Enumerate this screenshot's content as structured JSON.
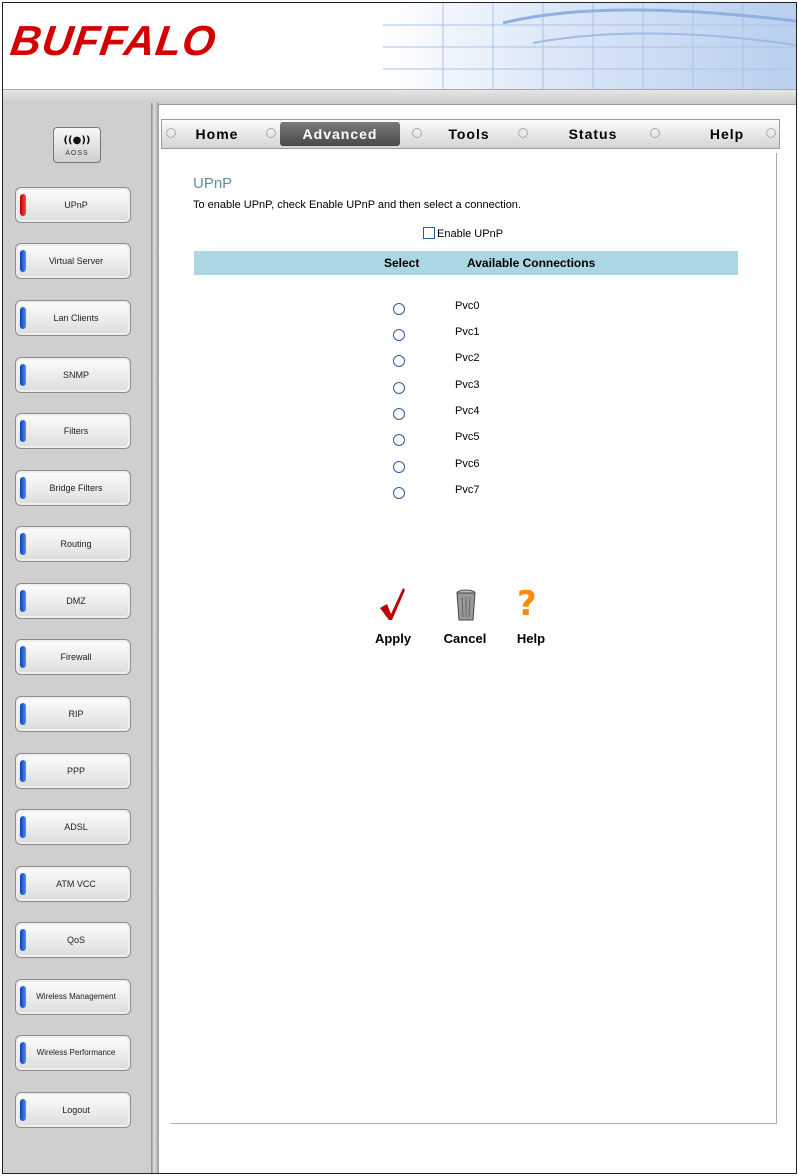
{
  "brand": {
    "logo_text": "BUFFALO"
  },
  "aoss": {
    "label": "AOSS"
  },
  "tabs": [
    {
      "label": "Home"
    },
    {
      "label": "Advanced"
    },
    {
      "label": "Tools"
    },
    {
      "label": "Status"
    },
    {
      "label": "Help"
    }
  ],
  "sidebar": {
    "items": [
      {
        "label": "UPnP"
      },
      {
        "label": "Virtual Server"
      },
      {
        "label": "Lan Clients"
      },
      {
        "label": "SNMP"
      },
      {
        "label": "Filters"
      },
      {
        "label": "Bridge Filters"
      },
      {
        "label": "Routing"
      },
      {
        "label": "DMZ"
      },
      {
        "label": "Firewall"
      },
      {
        "label": "RIP"
      },
      {
        "label": "PPP"
      },
      {
        "label": "ADSL"
      },
      {
        "label": "ATM VCC"
      },
      {
        "label": "QoS"
      },
      {
        "label": "Wireless Management"
      },
      {
        "label": "Wireless Performance"
      },
      {
        "label": "Logout"
      }
    ]
  },
  "main": {
    "title": "UPnP",
    "description": "To enable UPnP, check Enable UPnP and then select a connection.",
    "enable_label": "Enable UPnP",
    "table": {
      "col_select": "Select",
      "col_connections": "Available Connections",
      "rows": [
        "Pvc0",
        "Pvc1",
        "Pvc2",
        "Pvc3",
        "Pvc4",
        "Pvc5",
        "Pvc6",
        "Pvc7"
      ]
    },
    "actions": {
      "apply": "Apply",
      "cancel": "Cancel",
      "help": "Help"
    }
  },
  "colors": {
    "logo": "#d40000",
    "title": "#5d8ea3",
    "table_header": "#abd7e5",
    "active_pill": "#d40000",
    "pill": "#1a55d0"
  }
}
